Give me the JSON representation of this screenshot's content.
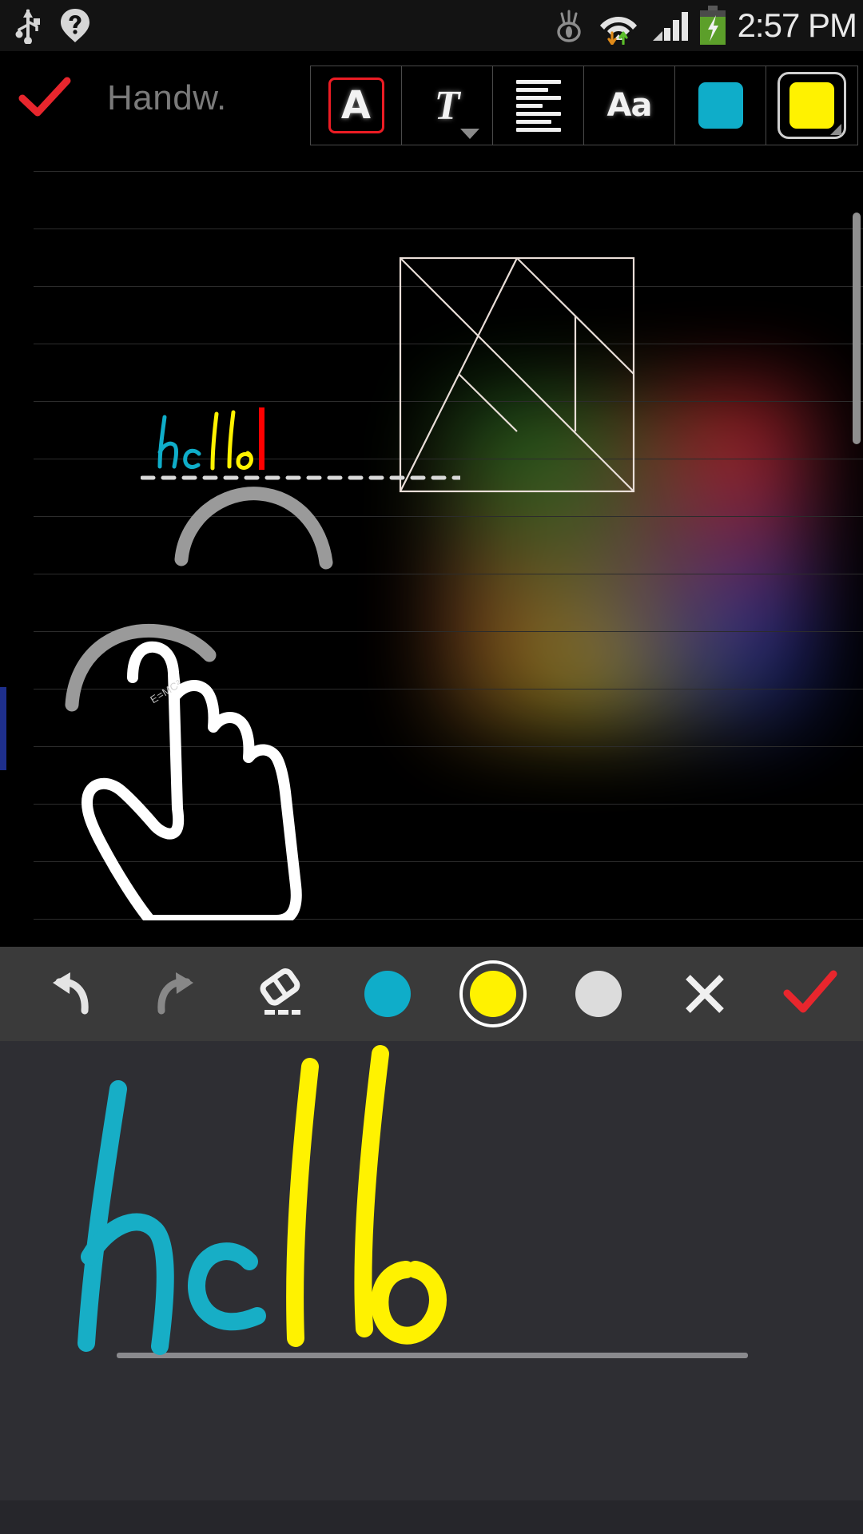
{
  "status_bar": {
    "icons": [
      "usb-icon",
      "unknown-sim-icon",
      "eye-icon",
      "wifi-icon",
      "data-transfer-icon",
      "signal-bars-icon",
      "battery-charging-icon"
    ],
    "time": "2:57 PM"
  },
  "top_bar": {
    "confirm_label": "done-check",
    "title": "Handw.",
    "expand_label": "chevron-down"
  },
  "format_toolbar": {
    "buttons": [
      {
        "name": "text-style-A",
        "label": "A",
        "selected": true
      },
      {
        "name": "font-style-T",
        "label": "T",
        "selected": false
      },
      {
        "name": "paragraph-align",
        "label": "align-left",
        "selected": false
      },
      {
        "name": "font-size-Aa",
        "label": "Aa",
        "selected": false
      },
      {
        "name": "color-cyan",
        "label": "cyan-swatch",
        "selected": false
      },
      {
        "name": "color-yellow",
        "label": "yellow-swatch",
        "selected": true
      }
    ],
    "cyan": "#0FADC9",
    "yellow": "#FFF200",
    "selection_outline": "#EC1C24"
  },
  "canvas": {
    "inline_text": "hello",
    "inline_text_part1": "he",
    "inline_text_part2": "llo",
    "cursor_color": "#FF0000",
    "micro_note": "E=MC²",
    "ruled_line_color": "#2C2C2C",
    "drawing_names": [
      "hand-drawing",
      "tangram-square-drawing",
      "color-glow-blob"
    ],
    "left_marker_color": "#1E2F8C",
    "scrollbar_color": "#8F8F8F"
  },
  "handwriting_panel": {
    "toolbar": [
      {
        "name": "undo-button",
        "label": "undo",
        "enabled": true
      },
      {
        "name": "redo-button",
        "label": "redo",
        "enabled": false
      },
      {
        "name": "eraser-button",
        "label": "eraser",
        "enabled": true
      },
      {
        "name": "pen-color-cyan",
        "label": "cyan",
        "color": "#0FADC9",
        "selected": false
      },
      {
        "name": "pen-color-yellow",
        "label": "yellow",
        "color": "#FFF200",
        "selected": true
      },
      {
        "name": "pen-color-white",
        "label": "white",
        "color": "#DCDCDC",
        "selected": false
      },
      {
        "name": "cancel-button",
        "label": "close",
        "enabled": true
      },
      {
        "name": "accept-button",
        "label": "accept",
        "enabled": true
      }
    ],
    "written_text": "hello",
    "written_part_cyan": "he",
    "written_part_yellow": "llo",
    "baseline_color": "#8A8A8E",
    "panel_bg": "#2E2E33"
  }
}
